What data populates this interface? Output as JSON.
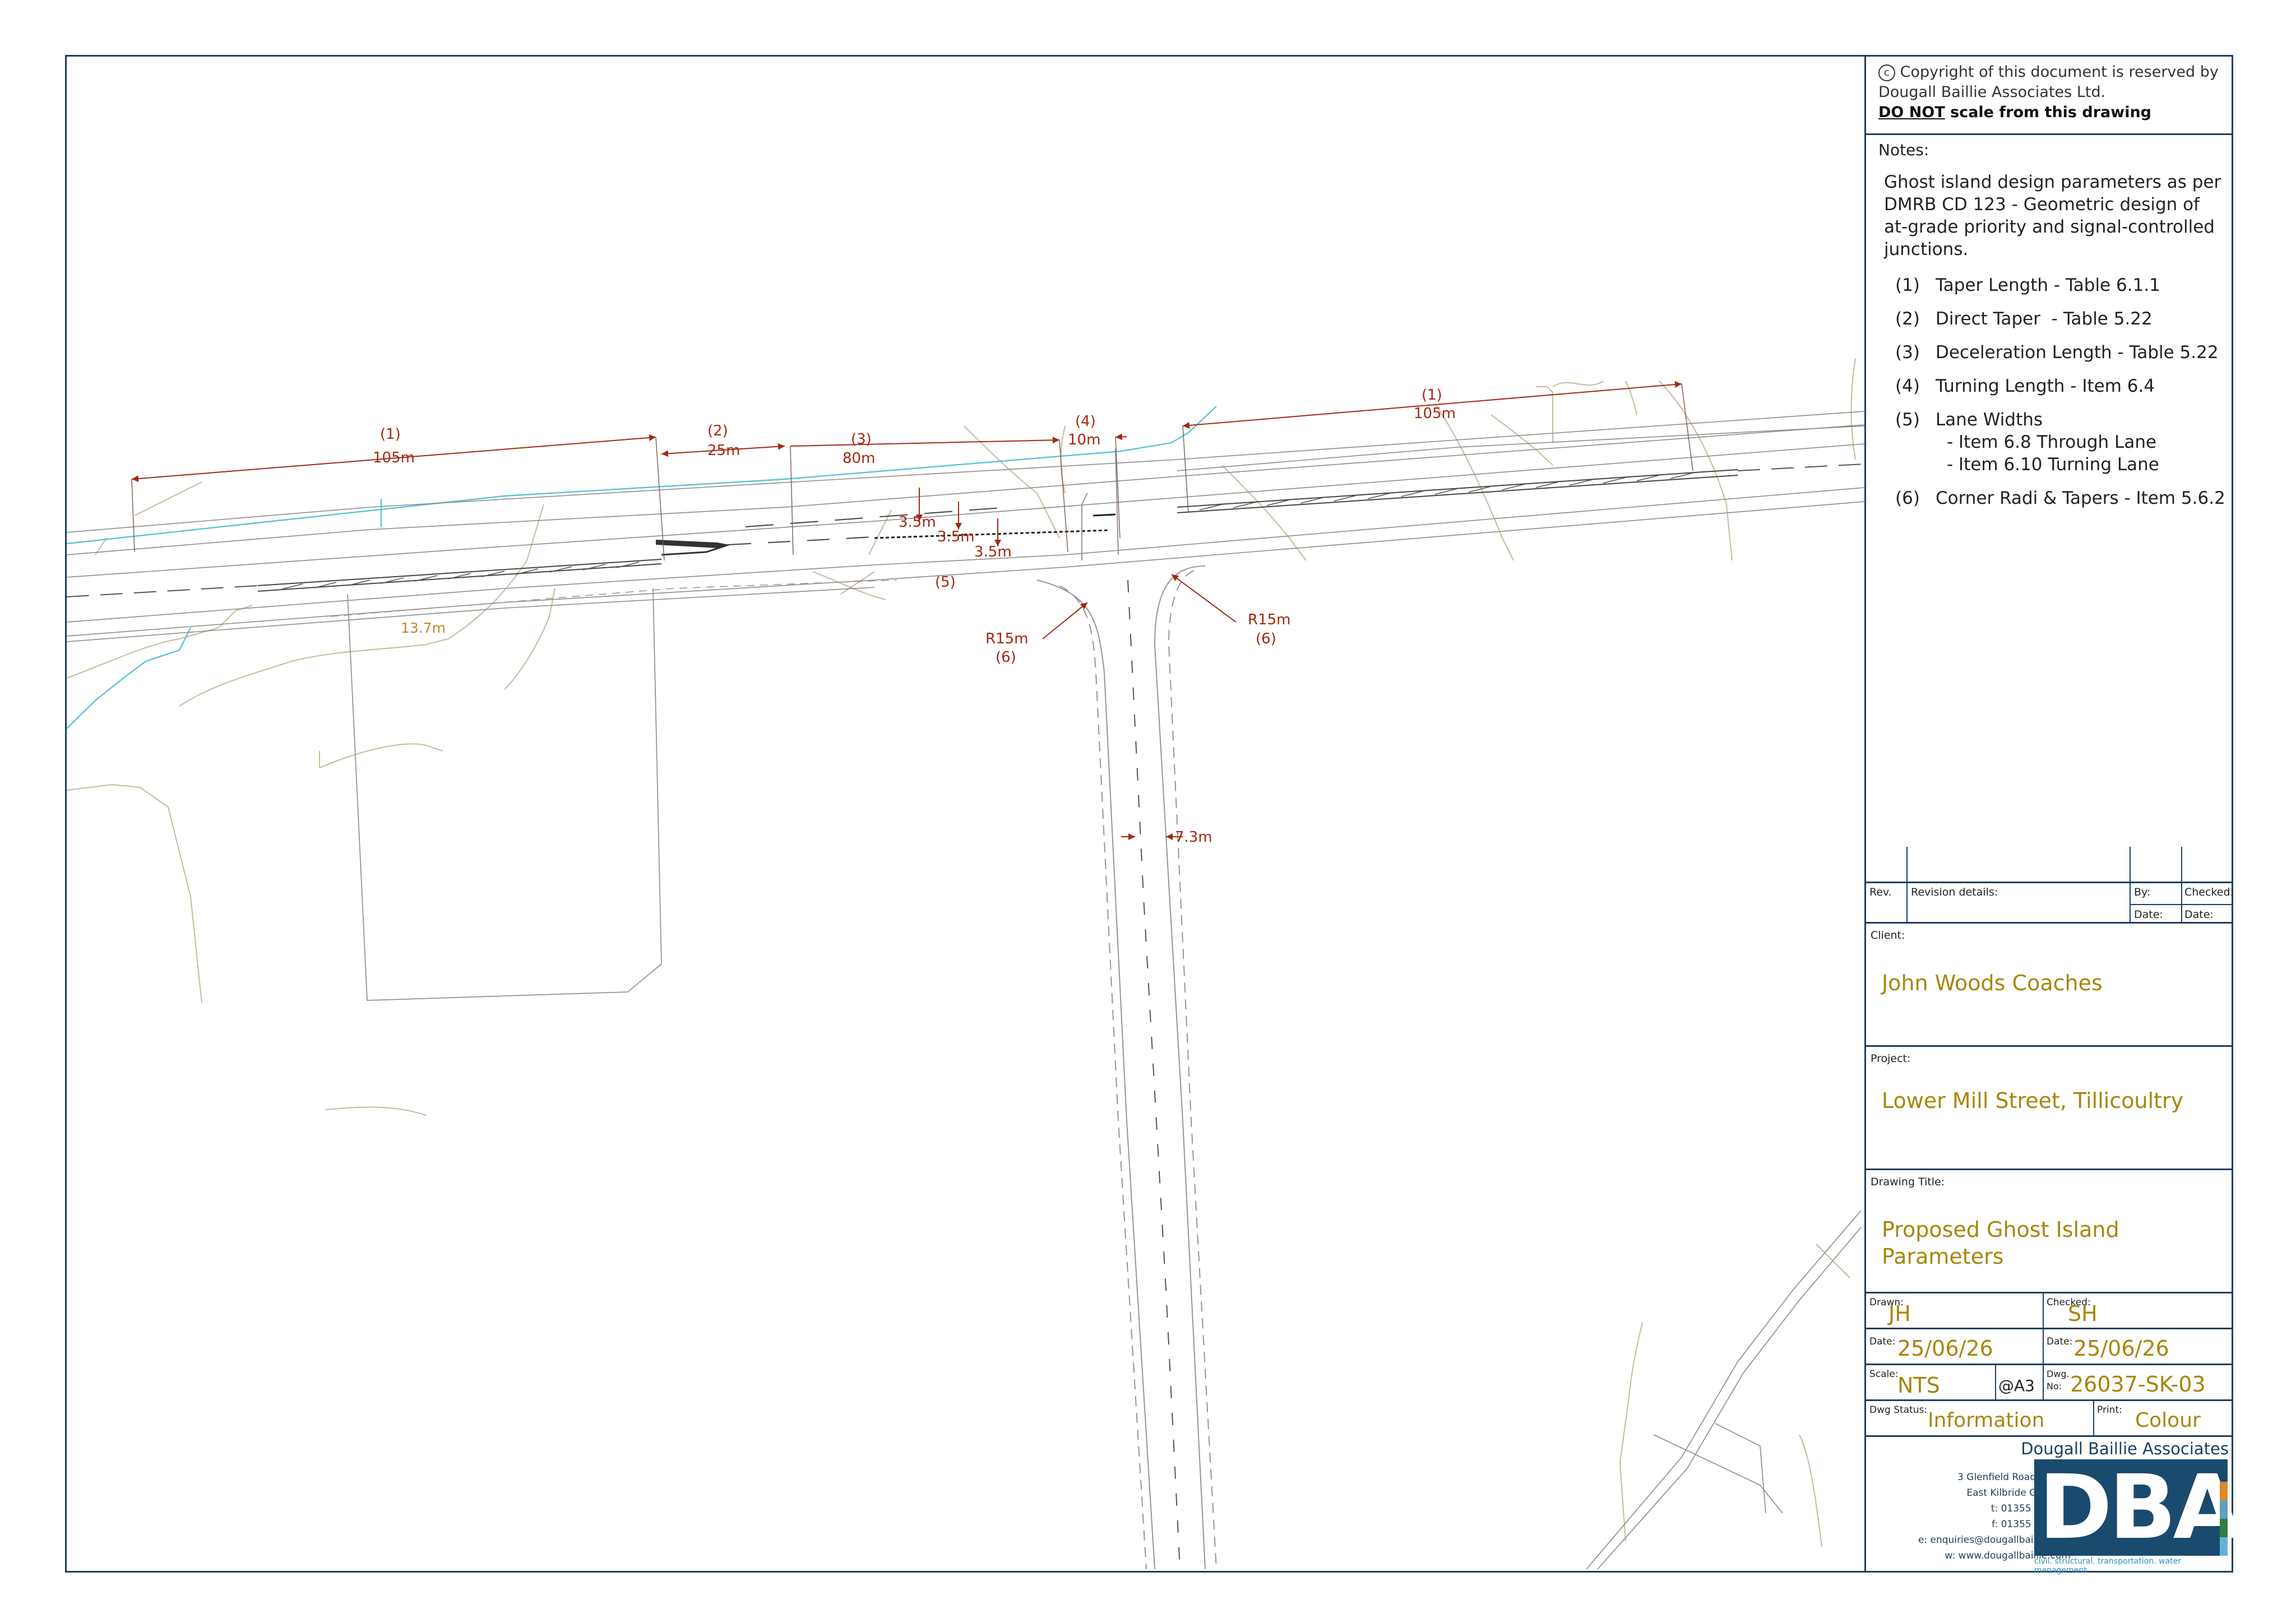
{
  "copyright": {
    "line1": "Copyright of this document is reserved by",
    "line2": "Dougall Baillie Associates Ltd.",
    "do_not": "DO NOT",
    "scale_text": " scale from this drawing"
  },
  "notes": {
    "heading": "Notes:",
    "intro": [
      "Ghost island design parameters as per",
      "DMRB CD 123 - Geometric design of",
      "at-grade priority and signal-controlled",
      "junctions."
    ],
    "items": [
      {
        "num": "(1)",
        "text": "Taper Length - Table 6.1.1"
      },
      {
        "num": "(2)",
        "text": "Direct Taper  - Table 5.22"
      },
      {
        "num": "(3)",
        "text": "Deceleration Length - Table 5.22"
      },
      {
        "num": "(4)",
        "text": "Turning Length - Item 6.4"
      },
      {
        "num": "(5)",
        "text": "Lane Widths"
      },
      {
        "num": "",
        "text": "- Item 6.8 Through Lane"
      },
      {
        "num": "",
        "text": "- Item 6.10 Turning Lane"
      },
      {
        "num": "(6)",
        "text": "Corner Radi & Tapers - Item 5.6.2"
      }
    ]
  },
  "revision": {
    "rev": "Rev.",
    "details": "Revision details:",
    "by": "By:",
    "checked": "Checked:",
    "date": "Date:",
    "date2": "Date:"
  },
  "client": {
    "label": "Client:",
    "value": "John Woods Coaches"
  },
  "project": {
    "label": "Project:",
    "value": "Lower Mill Street, Tillicoultry"
  },
  "drawing_title": {
    "label": "Drawing Title:",
    "line1": "Proposed Ghost Island",
    "line2": "Parameters"
  },
  "fields": {
    "drawn_label": "Drawn:",
    "drawn": "JH",
    "checked_label": "Checked:",
    "checked": "SH",
    "date_label": "Date:",
    "date": "25/06/26",
    "date2_label": "Date:",
    "date2": "25/06/26",
    "scale_label": "Scale:",
    "scale": "NTS",
    "paper": "@A3",
    "dwg_label1": "Dwg.",
    "dwg_label2": "No:",
    "dwg_no": "26037-SK-03",
    "status_label": "Dwg Status:",
    "status": "Information",
    "print_label": "Print:",
    "print": "Colour"
  },
  "company": {
    "name": "Dougall Baillie Associates",
    "logo": "DBA",
    "address": [
      "3 Glenfield Road, Kelvin",
      "East Kilbride G75 0RA",
      "t: 01355 266480",
      "f: 01355 221991",
      "e: enquiries@dougallbaillie.com",
      "w: www.dougallbaillie.com"
    ],
    "tagline": "civil. structural. transportation. water management."
  },
  "dimensions": {
    "d1_num": "(1)",
    "d1": "105m",
    "d2_num": "(2)",
    "d2": "25m",
    "d3_num": "(3)",
    "d3": "80m",
    "d4_num": "(4)",
    "d4": "10m",
    "d5_num": "(1)",
    "d5": "105m",
    "lane1": "3.5m",
    "lane2": "3.5m",
    "lane3": "3.5m",
    "lane_num": "(5)",
    "r1": "R15m",
    "r1_num": "(6)",
    "r2": "R15m",
    "r2_num": "(6)",
    "width": "7.3m",
    "verge": "13.7m"
  },
  "colors": {
    "border": "#1c3f5e",
    "dimension": "#a12a12",
    "accent": "#a8860b",
    "water": "#5bc3d8",
    "contour": "#c9b99a"
  }
}
